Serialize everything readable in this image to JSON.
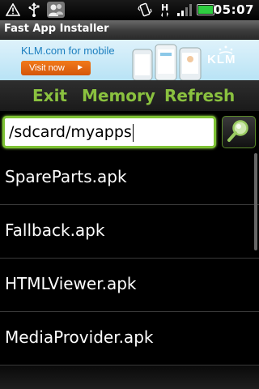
{
  "status_bar": {
    "time": "05:07",
    "network_type": "H",
    "icons": [
      "alert-icon",
      "usb-icon",
      "contacts-icon",
      "vibrate-icon",
      "signal-icon",
      "battery-icon"
    ],
    "battery_color": "#2ecc40"
  },
  "app": {
    "title": "Fast App Installer"
  },
  "ad": {
    "text": "KLM.com for mobile",
    "button_label": "Visit now",
    "brand": "KLM",
    "background": "#c6e9f7",
    "button_color": "#e8681a"
  },
  "menu": {
    "exit_label": "Exit",
    "memory_label": "Memory",
    "refresh_label": "Refresh",
    "accent_color": "#8ac13f"
  },
  "path": {
    "value": "/sdcard/myapps"
  },
  "files": [
    {
      "name": "SpareParts.apk"
    },
    {
      "name": "Fallback.apk"
    },
    {
      "name": "HTMLViewer.apk"
    },
    {
      "name": "MediaProvider.apk"
    }
  ]
}
